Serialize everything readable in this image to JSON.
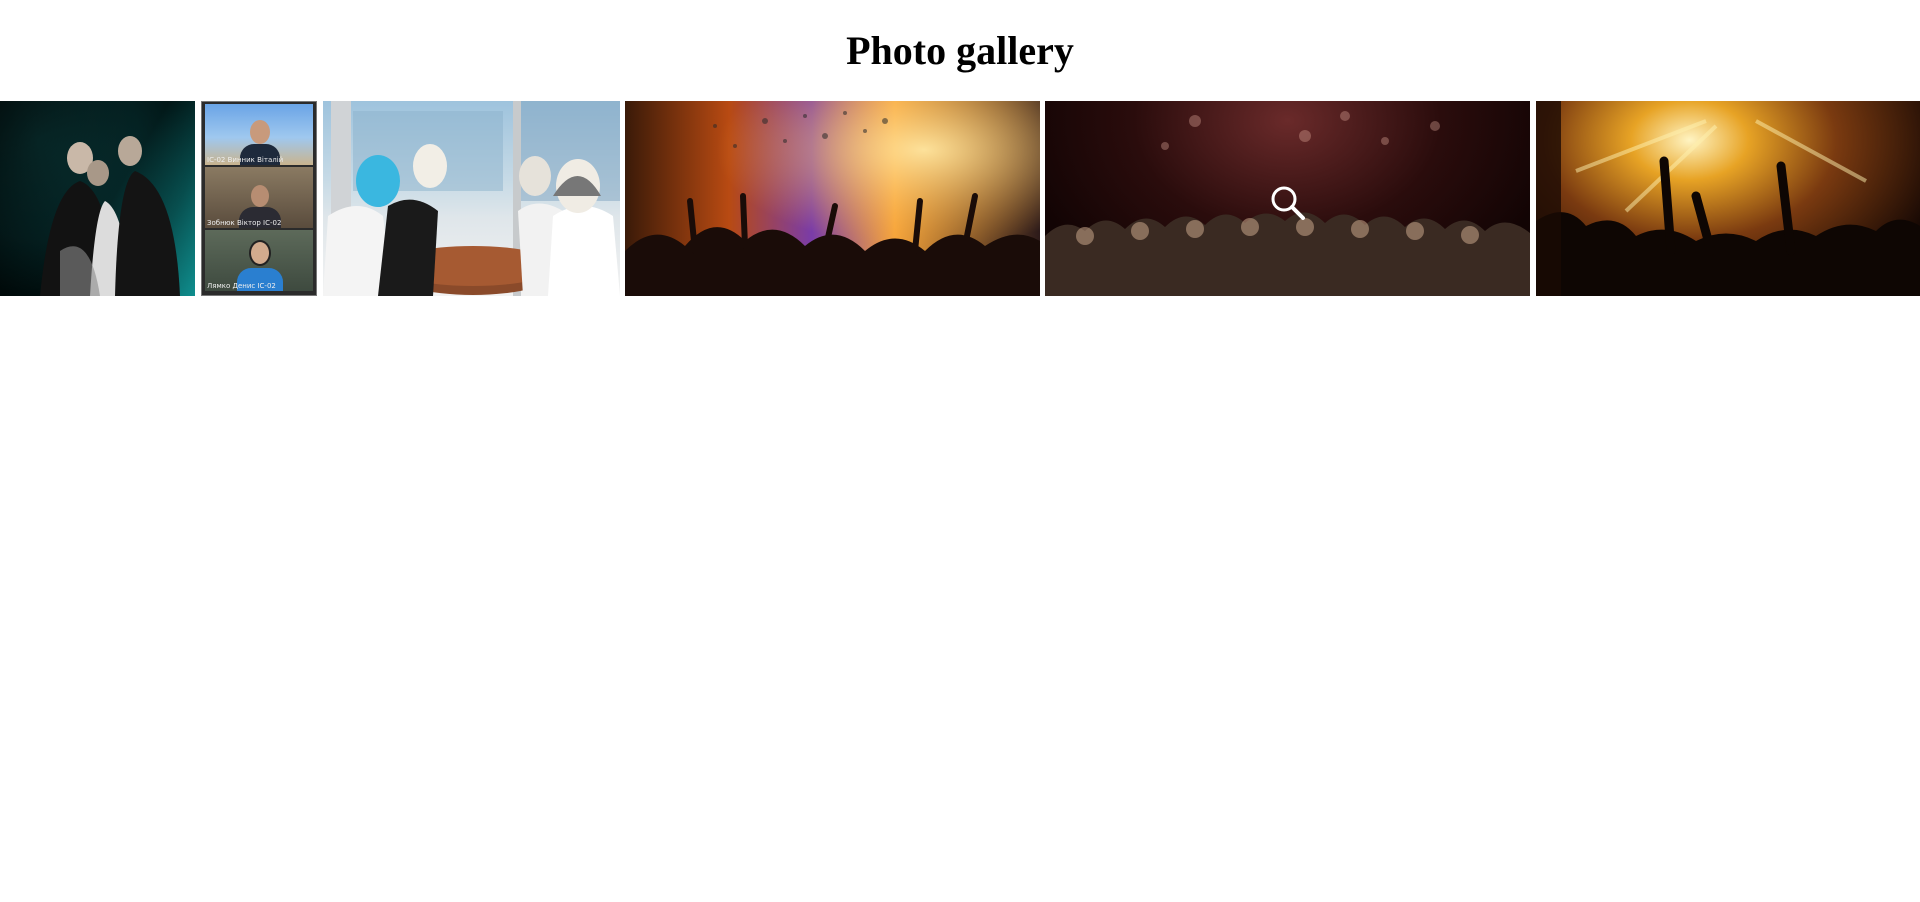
{
  "page": {
    "title": "Photo gallery"
  },
  "gallery": {
    "photos": [
      {
        "id": "photo-1",
        "description": "party selfie"
      },
      {
        "id": "photo-2",
        "description": "video call grid"
      },
      {
        "id": "photo-3",
        "description": "masked meeting"
      },
      {
        "id": "photo-4",
        "description": "confetti concert"
      },
      {
        "id": "photo-5",
        "description": "concert crowd"
      },
      {
        "id": "photo-6",
        "description": "stage lights crowd"
      }
    ],
    "call_tiles": [
      {
        "name": "ІС-02 Винник Віталій"
      },
      {
        "name": "Зобнюк Віктор ІС-02"
      },
      {
        "name": "Лямко Денис ІС-02"
      }
    ],
    "hover_icon": "search-icon"
  }
}
